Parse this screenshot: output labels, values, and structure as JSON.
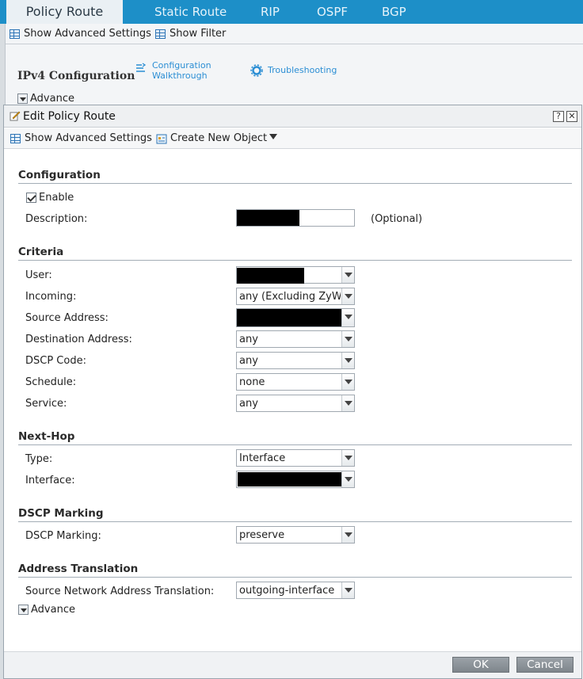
{
  "tabs": [
    "Policy Route",
    "Static Route",
    "RIP",
    "OSPF",
    "BGP"
  ],
  "bg_toolbar": {
    "show_advanced": "Show Advanced Settings",
    "show_filter": "Show Filter"
  },
  "bg_section": {
    "title": "IPv4 Configuration",
    "walkthrough_line1": "Configuration",
    "walkthrough_line2": "Walkthrough",
    "troubleshooting": "Troubleshooting",
    "advance": "Advance"
  },
  "dialog": {
    "title": "Edit Policy Route",
    "help_btn": "?",
    "close_btn": "✕",
    "toolbar": {
      "show_advanced": "Show Advanced Settings",
      "create_new_object": "Create New Object"
    },
    "configuration": {
      "title": "Configuration",
      "enable_label": "Enable",
      "description_label": "Description:",
      "description_hint": "(Optional)"
    },
    "criteria": {
      "title": "Criteria",
      "user_label": "User:",
      "incoming_label": "Incoming:",
      "incoming_value": "any (Excluding ZyW",
      "source_label": "Source Address:",
      "destination_label": "Destination Address:",
      "destination_value": "any",
      "dscp_label": "DSCP Code:",
      "dscp_value": "any",
      "schedule_label": "Schedule:",
      "schedule_value": "none",
      "service_label": "Service:",
      "service_value": "any"
    },
    "nexthop": {
      "title": "Next-Hop",
      "type_label": "Type:",
      "type_value": "Interface",
      "interface_label": "Interface:"
    },
    "dscp_marking": {
      "title": "DSCP Marking",
      "label": "DSCP Marking:",
      "value": "preserve"
    },
    "address_translation": {
      "title": "Address Translation",
      "snat_label": "Source Network Address Translation:",
      "snat_value": "outgoing-interface",
      "advance": "Advance"
    },
    "ok": "OK",
    "cancel": "Cancel"
  }
}
